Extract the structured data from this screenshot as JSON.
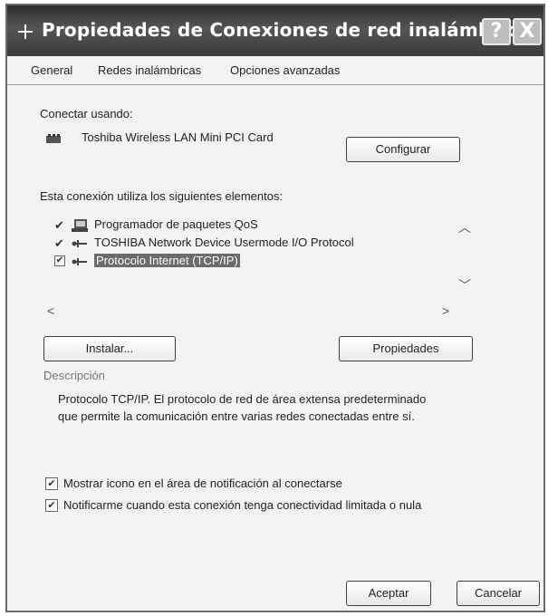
{
  "window": {
    "title": "Propiedades de Conexiones de red inalámbricas",
    "help_label": "?",
    "close_label": "X"
  },
  "tabs": [
    {
      "label": "General",
      "active": true
    },
    {
      "label": "Redes inalámbricas",
      "active": false
    },
    {
      "label": "Opciones avanzadas",
      "active": false
    }
  ],
  "connect": {
    "label": "Conectar usando:",
    "adapter": "Toshiba Wireless LAN Mini PCI Card",
    "configure_label": "Configurar"
  },
  "elements": {
    "label": "Esta conexión utiliza los siguientes elementos:",
    "items": [
      {
        "label": "Programador de paquetes QoS",
        "checked": true,
        "icon": "qos-scheduler-icon"
      },
      {
        "label": "TOSHIBA Network Device Usermode I/O Protocol",
        "checked": true,
        "icon": "protocol-icon"
      },
      {
        "label": "Protocolo Internet (TCP/IP)",
        "checked": true,
        "icon": "protocol-icon",
        "selected": true
      }
    ]
  },
  "buttons": {
    "install": "Instalar...",
    "properties": "Propiedades",
    "ok": "Aceptar",
    "cancel": "Cancelar"
  },
  "description": {
    "label": "Descripción",
    "text": "Protocolo TCP/IP. El protocolo de red de área extensa predeterminado que permite la comunicación entre varias redes conectadas entre sí."
  },
  "options": [
    {
      "label": "Mostrar icono en el área de notificación al conectarse",
      "checked": true
    },
    {
      "label": "Notificarme cuando esta conexión tenga conectividad limitada o nula",
      "checked": true
    }
  ]
}
